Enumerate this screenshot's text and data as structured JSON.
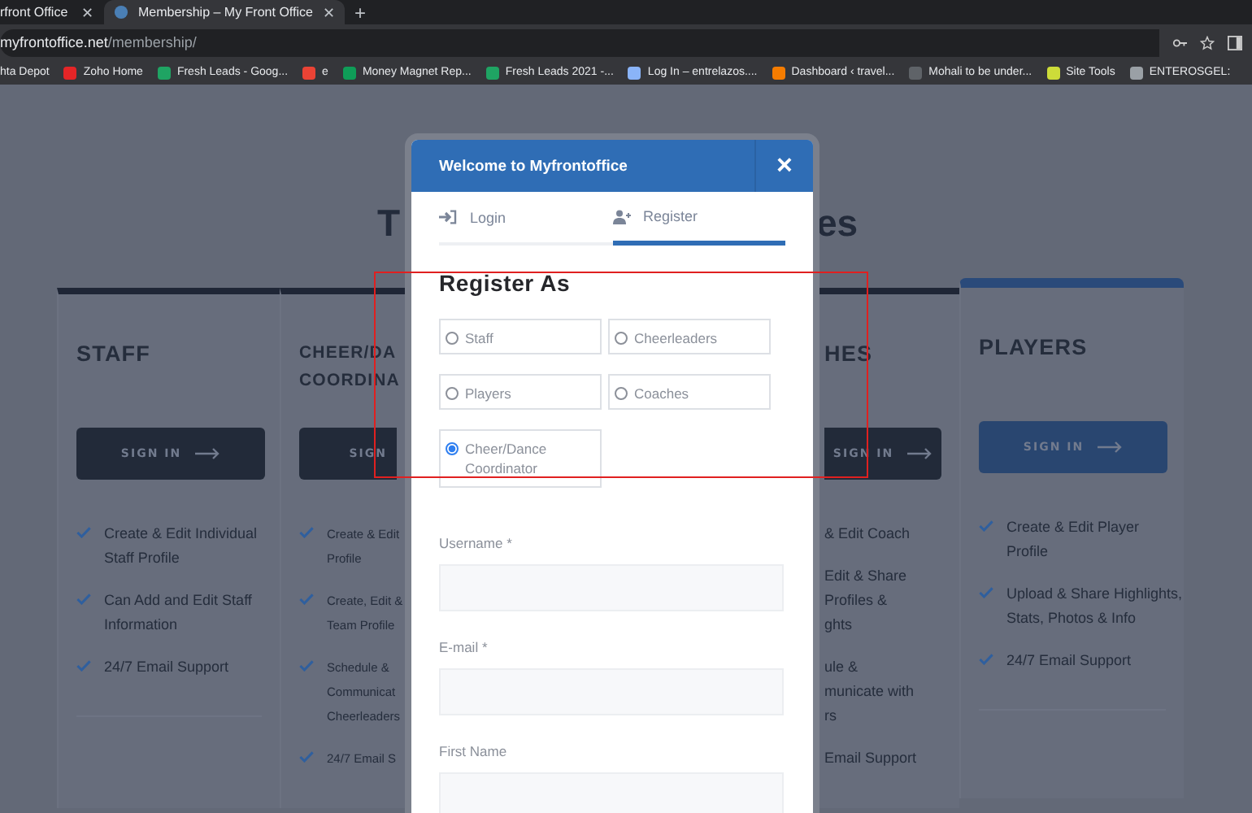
{
  "browser": {
    "tabs": [
      {
        "title": "rfront Office",
        "close": "✕",
        "selected": false
      },
      {
        "title": "Membership – My Front Office",
        "close": "✕",
        "selected": true
      }
    ],
    "new_tab": "+",
    "address": {
      "host": "myfrontoffice.net",
      "path": "/membership/"
    },
    "bookmarks": [
      {
        "label": "hta Depot"
      },
      {
        "label": "Zoho Home",
        "color": "#e42527"
      },
      {
        "label": "Fresh Leads - Goog...",
        "color": "#1fa463"
      },
      {
        "label": "e",
        "color": "#ea4335"
      },
      {
        "label": "Money Magnet Rep...",
        "color": "#0f9d58"
      },
      {
        "label": "Fresh Leads 2021 -...",
        "color": "#1fa463"
      },
      {
        "label": "Log In – entrelazos....",
        "color": "#8ab4f8"
      },
      {
        "label": "Dashboard ‹ travel...",
        "color": "#f57c00"
      },
      {
        "label": "Mohali to be under...",
        "color": "#5f6368"
      },
      {
        "label": "Site Tools",
        "color": "#cddc39"
      },
      {
        "label": "ENTEROSGEL:",
        "color": "#9aa0a6"
      }
    ]
  },
  "page": {
    "heading_parts": [
      "T",
      "es"
    ],
    "cards": [
      {
        "kind": "whole",
        "highlighted": false,
        "title": [
          "STAFF"
        ],
        "sign_in": "SIGN IN",
        "features": [
          "Create & Edit Individual Staff Profile",
          "Can Add and Edit Staff Information",
          "24/7 Email Support"
        ]
      },
      {
        "kind": "cut_right",
        "highlighted": false,
        "title": [
          "CHEER/DA",
          "COORDINA"
        ],
        "sign_in": "SIGN",
        "features": [
          [
            "Create & Edit",
            "Profile"
          ],
          [
            "Create, Edit &",
            "Team Profile"
          ],
          [
            "Schedule &",
            "Communicat",
            "Cheerleaders"
          ],
          [
            "24/7 Email S"
          ]
        ]
      },
      {
        "kind": "cut_left",
        "highlighted": false,
        "title": [
          "HES"
        ],
        "sign_in": "SIGN IN",
        "features": [
          [
            "& Edit Coach"
          ],
          [
            "Edit & Share",
            "Profiles &",
            "ghts"
          ],
          [
            "ule &",
            "municate with",
            "rs"
          ],
          [
            "Email Support"
          ]
        ]
      },
      {
        "kind": "whole",
        "highlighted": true,
        "title": [
          "PLAYERS"
        ],
        "sign_in": "SIGN IN",
        "features": [
          "Create & Edit Player Profile",
          "Upload & Share Highlights, Stats, Photos & Info",
          "24/7 Email Support"
        ]
      }
    ]
  },
  "modal": {
    "title": "Welcome to Myfrontoffice",
    "close": "×",
    "tabs": [
      {
        "label": "Login",
        "selected": false
      },
      {
        "label": "Register",
        "selected": true
      }
    ],
    "section_title": "Register As",
    "roles": [
      {
        "label": "Staff",
        "selected": false
      },
      {
        "label": "Cheerleaders",
        "selected": false
      },
      {
        "label": "Players",
        "selected": false
      },
      {
        "label": "Coaches",
        "selected": false
      },
      {
        "label": "Cheer/Dance Coordinator",
        "selected": true
      }
    ],
    "fields": [
      {
        "label": "Username *"
      },
      {
        "label": "E-mail *"
      },
      {
        "label": "First Name"
      }
    ]
  }
}
